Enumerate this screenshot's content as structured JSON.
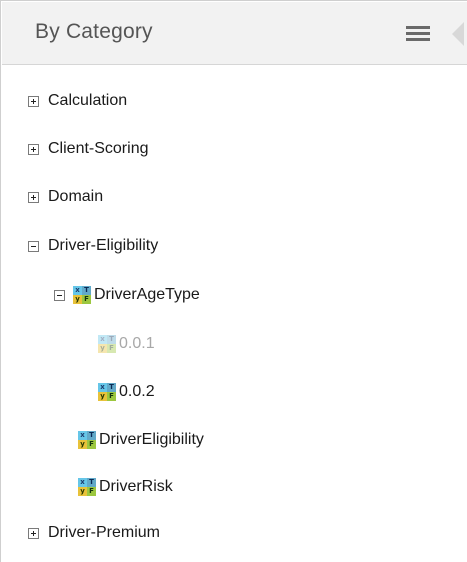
{
  "header": {
    "title": "By Category",
    "menu_icon": "hamburger-menu-icon",
    "collapse_icon": "collapse-left-arrow-icon"
  },
  "tree": {
    "decision_table_icon_letters": [
      "x",
      "T",
      "y",
      "F"
    ],
    "nodes": [
      {
        "label": "Calculation",
        "state": "collapsed"
      },
      {
        "label": "Client-Scoring",
        "state": "collapsed"
      },
      {
        "label": "Domain",
        "state": "collapsed"
      },
      {
        "label": "Driver-Eligibility",
        "state": "expanded"
      },
      {
        "label": "DriverAgeType",
        "state": "expanded",
        "icon": "decision-table-icon"
      },
      {
        "label": "0.0.1",
        "icon": "decision-table-icon",
        "disabled": true
      },
      {
        "label": "0.0.2",
        "icon": "decision-table-icon"
      },
      {
        "label": "DriverEligibility",
        "icon": "decision-table-icon"
      },
      {
        "label": "DriverRisk",
        "icon": "decision-table-icon"
      },
      {
        "label": "Driver-Premium",
        "state": "collapsed"
      }
    ]
  }
}
